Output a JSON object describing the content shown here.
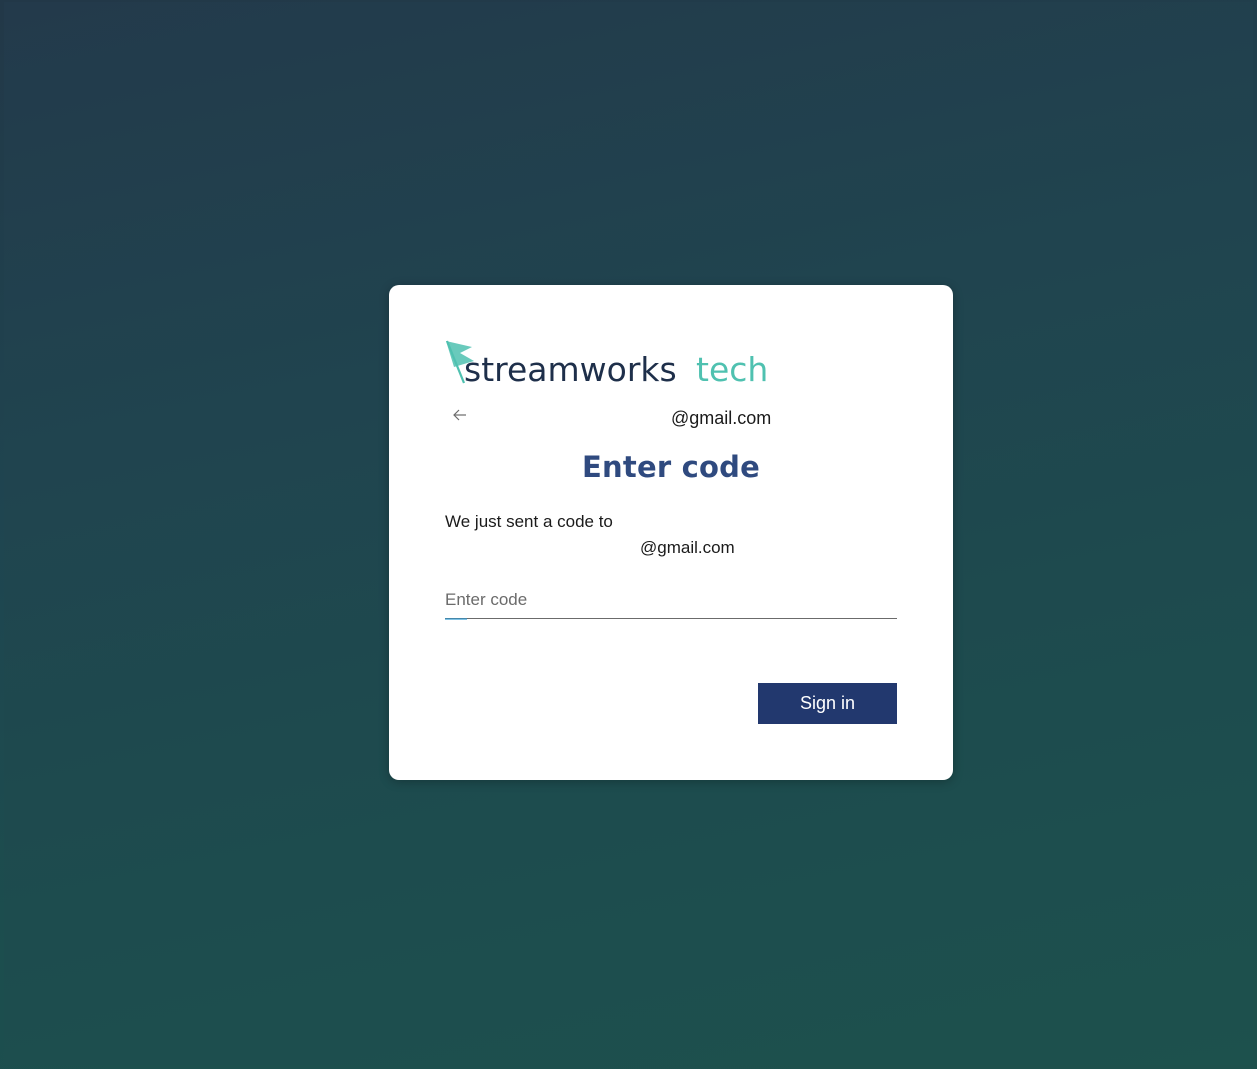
{
  "brand": {
    "logo_text_primary": "streamworks",
    "logo_text_secondary": "tech",
    "primary_color": "#1e2f4a",
    "accent_color": "#4fc1b0"
  },
  "identity": {
    "back_icon": "arrow-left-icon",
    "email": "@gmail.com"
  },
  "title": "Enter code",
  "description": {
    "line1": "We just sent a code to",
    "line2": "@gmail.com"
  },
  "code_field": {
    "placeholder": "Enter code",
    "value": ""
  },
  "sign_in_label": "Sign in",
  "colors": {
    "button_bg": "#22386e",
    "title": "#2f4a7f"
  }
}
